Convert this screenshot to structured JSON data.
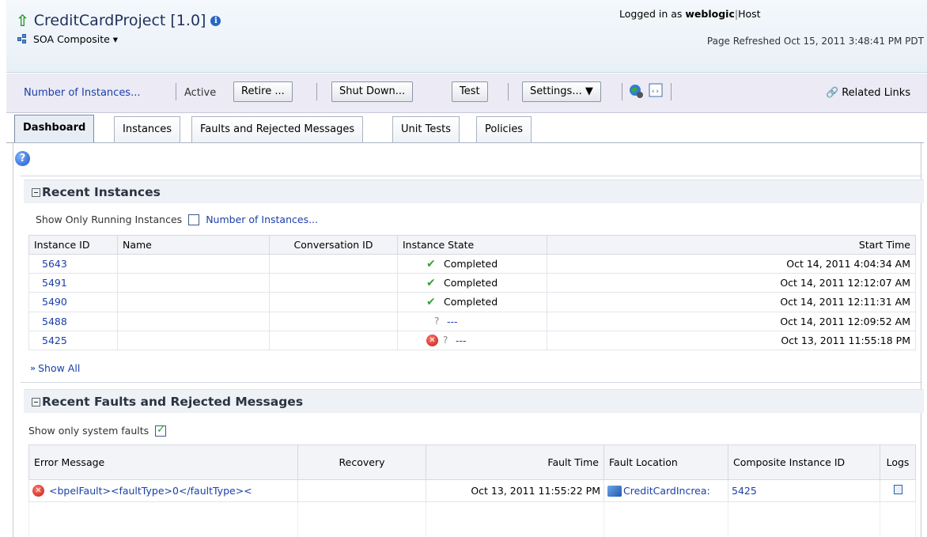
{
  "header": {
    "title": "CreditCardProject [1.0]",
    "subtitle": "SOA Composite",
    "login_prefix": "Logged in as ",
    "login_user": "weblogic",
    "login_host": "Host",
    "refreshed": "Page Refreshed Oct 15, 2011 3:48:41 PM PDT"
  },
  "toolbar": {
    "instances_link": "Number of Instances...",
    "status": "Active",
    "retire": "Retire ...",
    "shutdown": "Shut Down...",
    "test": "Test",
    "settings": "Settings... ▼",
    "related": "Related Links"
  },
  "tabs": [
    "Dashboard",
    "Instances",
    "Faults and Rejected Messages",
    "Unit Tests",
    "Policies"
  ],
  "recent_instances": {
    "title": "Recent Instances",
    "running_label": "Show Only Running Instances",
    "running_checked": false,
    "instances_link": "Number of Instances...",
    "columns": [
      "Instance ID",
      "Name",
      "Conversation ID",
      "Instance State",
      "Start Time"
    ],
    "rows": [
      {
        "id": "5643",
        "name": "",
        "conv": "",
        "state": "Completed",
        "state_kind": "ok",
        "start": "Oct 14, 2011 4:04:34 AM"
      },
      {
        "id": "5491",
        "name": "",
        "conv": "",
        "state": "Completed",
        "state_kind": "ok",
        "start": "Oct 14, 2011 12:12:07 AM"
      },
      {
        "id": "5490",
        "name": "",
        "conv": "",
        "state": "Completed",
        "state_kind": "ok",
        "start": "Oct 14, 2011 12:11:31 AM"
      },
      {
        "id": "5488",
        "name": "",
        "conv": "",
        "state": "---",
        "state_kind": "unknown",
        "start": "Oct 14, 2011 12:09:52 AM"
      },
      {
        "id": "5425",
        "name": "",
        "conv": "",
        "state": "---",
        "state_kind": "error",
        "start": "Oct 13, 2011 11:55:18 PM"
      }
    ],
    "show_all": "Show All"
  },
  "recent_faults": {
    "title": "Recent Faults and Rejected Messages",
    "system_label": "Show only system faults",
    "system_checked": true,
    "columns": [
      "Error Message",
      "Recovery",
      "Fault Time",
      "Fault Location",
      "Composite Instance ID",
      "Logs"
    ],
    "rows": [
      {
        "error": "<bpelFault><faultType>0</faultType><",
        "recovery": "",
        "time": "Oct 13, 2011 11:55:22 PM",
        "location": "CreditCardIncrea:",
        "composite_id": "5425"
      }
    ]
  },
  "colors": {
    "link": "#1a3fa8",
    "ok": "#37a13c",
    "error": "#c11a12",
    "toolbar_bg": "#ecebf5"
  }
}
